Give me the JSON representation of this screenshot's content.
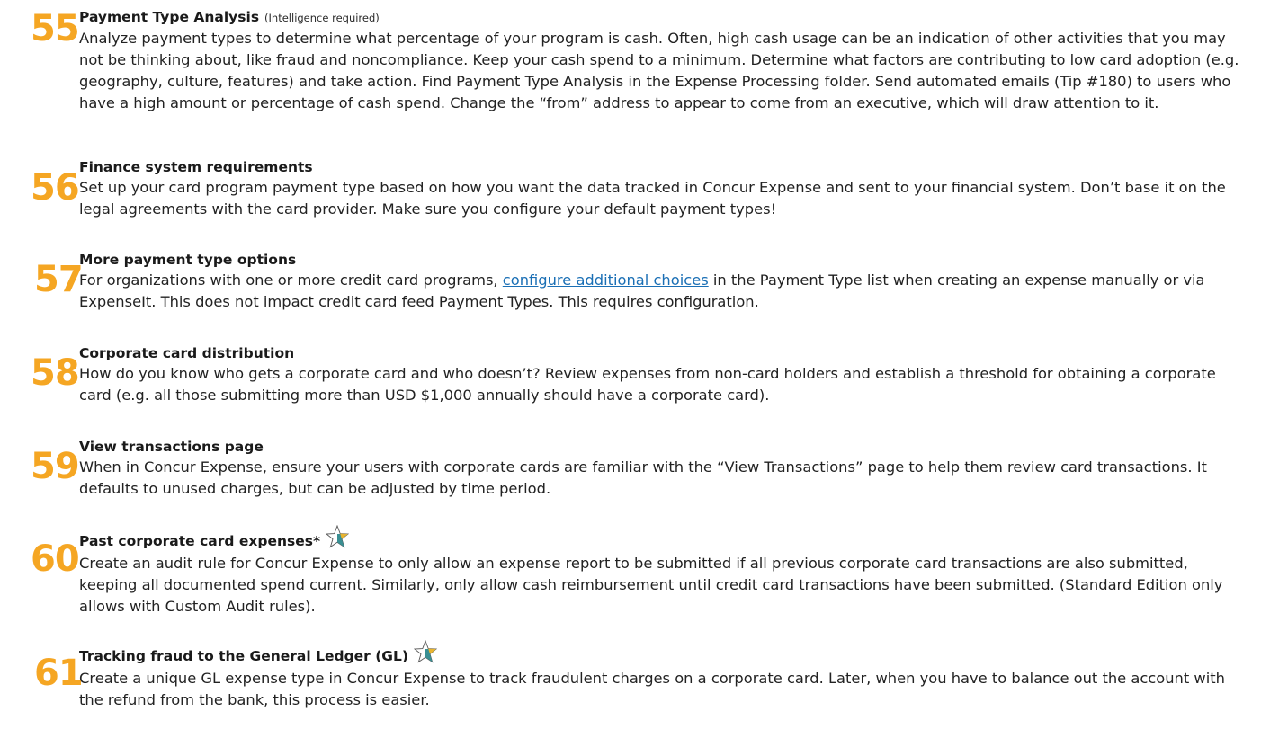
{
  "tips": [
    {
      "number": "55",
      "title": "Payment Type Analysis",
      "note": "(Intelligence required)",
      "text": "Analyze payment types to determine what percentage of your program is cash. Often, high cash usage can be an indication of other activities that you may not be thinking about, like fraud and noncompliance. Keep your cash spend to a minimum. Determine what factors are contributing to low card adoption (e.g. geography, culture, features) and take action. Find Payment Type Analysis in the Expense Processing folder. Send automated emails (Tip #180) to users who have a high amount or percentage of cash spend. Change the “from” address to appear to come from an executive, which will draw attention to it."
    },
    {
      "number": "56",
      "title": "Finance system requirements",
      "text": "Set up your card program payment type based on how you want the data tracked in Concur Expense and sent to your financial system. Don’t base it on the legal agreements with the card provider. Make sure you configure your default payment types!"
    },
    {
      "number": "57",
      "title": "More payment type options",
      "text_before": "For organizations with one or more credit card programs, ",
      "link": "configure additional choices",
      "text_after": " in the Payment Type list when creating an expense manually or via ExpenseIt. This does not impact credit card feed Payment Types. This requires configuration."
    },
    {
      "number": "58",
      "title": "Corporate card distribution",
      "text": "How do you know who gets a corporate card and who doesn’t? Review expenses from non-card holders and establish a threshold for obtaining a corporate card (e.g. all those submitting more than USD $1,000 annually should have a corporate card)."
    },
    {
      "number": "59",
      "title": "View transactions page",
      "text": "When in Concur Expense, ensure your users with corporate cards are familiar with the “View Transactions” page to help them review card transactions. It defaults to unused charges, but can be adjusted by time period."
    },
    {
      "number": "60",
      "title": "Past corporate card expenses*",
      "icon": "star-icon",
      "text": "Create an audit rule for Concur Expense to only allow an expense report to be submitted if all previous corporate card transactions are also submitted, keeping all documented spend current. Similarly, only allow cash reimbursement until credit card transactions have been submitted. (Standard Edition only allows with Custom Audit rules)."
    },
    {
      "number": "61",
      "title": "Tracking fraud to the General Ledger (GL)",
      "icon": "star-icon",
      "text": "Create a unique GL expense type in Concur Expense to track fraudulent charges on a corporate card. Later, when you have to balance out the account with the refund from the bank, this process is easier."
    }
  ],
  "colors": {
    "number": "#f5a623",
    "link": "#1a6fb5",
    "star_teal": "#3a8f93",
    "star_gold": "#e8b430"
  }
}
